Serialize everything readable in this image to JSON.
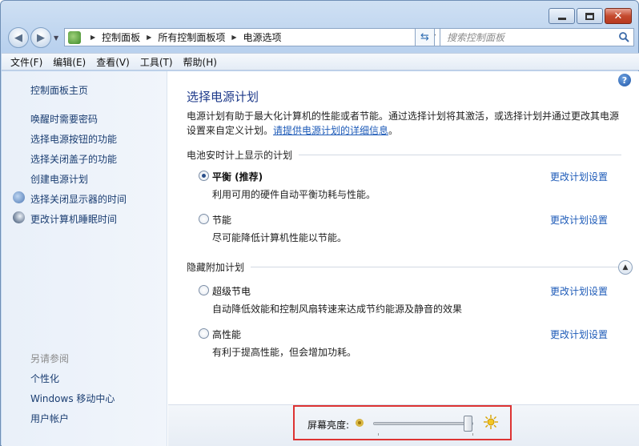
{
  "window": {
    "caption_buttons": {
      "minimize": "minimize-icon",
      "maximize": "maximize-icon",
      "close": "close-icon"
    }
  },
  "nav": {
    "breadcrumbs": [
      "控制面板",
      "所有控制面板项",
      "电源选项"
    ],
    "search_placeholder": "搜索控制面板"
  },
  "menu": [
    "文件(F)",
    "编辑(E)",
    "查看(V)",
    "工具(T)",
    "帮助(H)"
  ],
  "sidebar": {
    "home": "控制面板主页",
    "links": [
      "唤醒时需要密码",
      "选择电源按钮的功能",
      "选择关闭盖子的功能",
      "创建电源计划",
      "选择关闭显示器的时间",
      "更改计算机睡眠时间"
    ],
    "see_also": "另请参阅",
    "see_also_links": [
      "个性化",
      "Windows 移动中心",
      "用户帐户"
    ]
  },
  "main": {
    "title": "选择电源计划",
    "desc_text": "电源计划有助于最大化计算机的性能或者节能。通过选择计划将其激活，或选择计划并通过更改其电源设置来自定义计划。",
    "desc_link": "请提供电源计划的详细信息",
    "desc_end": "。",
    "section_battery": "电池安时计上显示的计划",
    "section_hidden": "隐藏附加计划",
    "plans": [
      {
        "name": "平衡 (推荐)",
        "desc": "利用可用的硬件自动平衡功耗与性能。",
        "link": "更改计划设置",
        "selected": true
      },
      {
        "name": "节能",
        "desc": "尽可能降低计算机性能以节能。",
        "link": "更改计划设置",
        "selected": false
      },
      {
        "name": "超级节电",
        "desc": "自动降低效能和控制风扇转速来达成节约能源及静音的效果",
        "link": "更改计划设置",
        "selected": false
      },
      {
        "name": "高性能",
        "desc": "有利于提高性能，但会增加功耗。",
        "link": "更改计划设置",
        "selected": false
      }
    ]
  },
  "brightness": {
    "label": "屏幕亮度:",
    "level": 1.0
  },
  "colors": {
    "link": "#1e5bb8",
    "title": "#1e3a8a",
    "highlight_box": "#d33333"
  }
}
